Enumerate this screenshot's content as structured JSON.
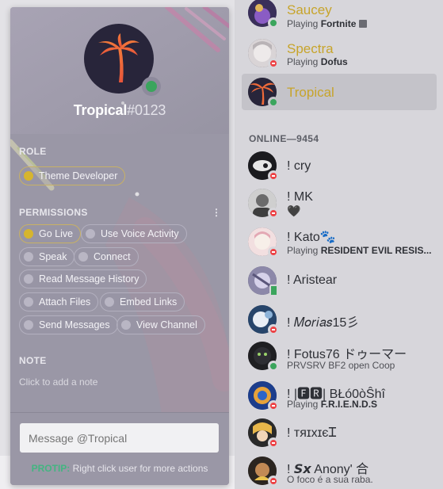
{
  "profile": {
    "username": "Tropical",
    "discriminator": "#0123",
    "avatar_icon": "palm-tree-icon",
    "status_color": "#3ba55d",
    "role_header": "ROLE",
    "roles": [
      "Theme Developer"
    ],
    "permissions_header": "PERMISSIONS",
    "permissions": [
      "Go Live",
      "Use Voice Activity",
      "Speak",
      "Connect",
      "Read Message History",
      "Attach Files",
      "Embed Links",
      "Send Messages",
      "View Channel"
    ],
    "note_header": "NOTE",
    "note_placeholder": "Click to add a note",
    "message_placeholder": "Message @Tropical",
    "protip_label": "PROTIP:",
    "protip_text": "Right click user for more actions"
  },
  "members": {
    "top": [
      {
        "name": "Saucey",
        "activity_prefix": "Playing",
        "activity_name": "Fortnite",
        "status": "online",
        "gold": true
      },
      {
        "name": "Spectra",
        "activity_prefix": "Playing",
        "activity_name": "Dofus",
        "status": "dnd",
        "gold": true
      },
      {
        "name": "Tropical",
        "status": "online",
        "gold": true,
        "selected": true
      }
    ],
    "online_header": "ONLINE—9454",
    "online": [
      {
        "name": "! cry",
        "status": "dnd"
      },
      {
        "name": "! MK",
        "status": "dnd",
        "custom": "🖤"
      },
      {
        "name": "! Kato🐾",
        "activity_prefix": "Playing",
        "activity_name": "RESIDENT EVIL RESIS...",
        "status": "dnd"
      },
      {
        "name": "! Aristear",
        "status": "mobile"
      },
      {
        "name": "! 𝑀𝑜𝑟𝑖𝑎𝑠15彡",
        "status": "dnd"
      },
      {
        "name": "! Fotus76 ドゥーマー",
        "custom": "PRVSRV BF2 open Coop",
        "status": "online"
      },
      {
        "name": "! |🅵🆁| BŁó0òŜhî",
        "activity_prefix": "Playing",
        "activity_name": "F.R.I.E.N.D.S",
        "status": "dnd"
      },
      {
        "name": "! ᴛяɪxɪєᏆ",
        "status": "dnd"
      },
      {
        "name": "! 𝙎𝙭 Anony' 合",
        "custom": "O foco é a sua raba.",
        "status": "dnd"
      }
    ]
  }
}
